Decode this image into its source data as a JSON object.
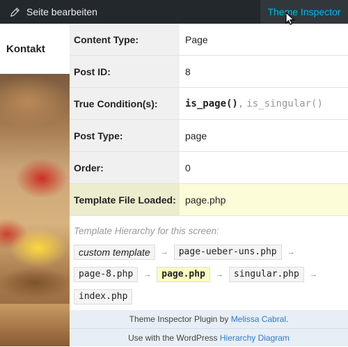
{
  "adminbar": {
    "edit_label": "Seite bearbeiten",
    "edit_icon": "pencil-icon",
    "inspector_label": "Theme Inspector"
  },
  "site": {
    "nav_item": "Kontakt"
  },
  "inspector": {
    "rows": [
      {
        "label": "Content Type:",
        "value": "Page"
      },
      {
        "label": "Post ID:",
        "value": "8"
      },
      {
        "label": "True Condition(s):",
        "conditions": [
          "is_page()",
          "is_singular()"
        ],
        "separator": ","
      },
      {
        "label": "Post Type:",
        "value": "page"
      },
      {
        "label": "Order:",
        "value": "0"
      },
      {
        "label": "Template File Loaded:",
        "value": "page.php"
      }
    ],
    "hierarchy_title": "Template Hierarchy for this screen:",
    "hierarchy": [
      "custom template",
      "page-ueber-uns.php",
      "page-8.php",
      "page.php",
      "singular.php",
      "index.php"
    ],
    "arrow": "→",
    "footer": {
      "line1_prefix": "Theme Inspector Plugin by ",
      "line1_link": "Melissa Cabral",
      "line1_suffix": ".",
      "line2_prefix": "Use with the WordPress ",
      "line2_link": "Hierarchy Diagram"
    }
  },
  "colors": {
    "adminbar_bg": "#23282d",
    "inspector_link": "#00b9eb",
    "highlight_row": "#fcfcd8",
    "footer_bg": "#e8eef5",
    "footer_link": "#2a7dcf"
  }
}
